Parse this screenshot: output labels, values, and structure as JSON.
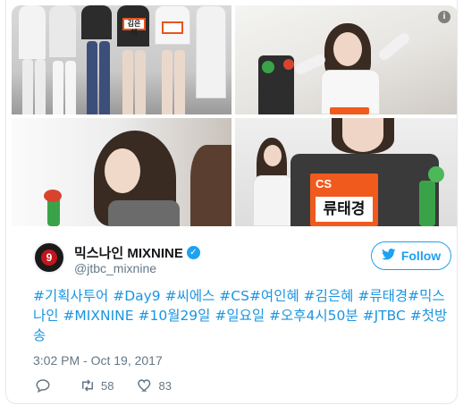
{
  "media": {
    "info_icon": "i"
  },
  "photo_labels": {
    "tag1": "김은혜",
    "tag2": "",
    "bib_team": "CS",
    "bib_name": "류태경"
  },
  "account": {
    "display_name": "믹스나인 MIXNINE",
    "handle": "@jtbc_mixnine",
    "avatar_glyph": "9",
    "verified_glyph": "✓"
  },
  "follow_button": {
    "label": "Follow",
    "icon": "twitter-bird-icon"
  },
  "tweet": {
    "text": "#기획사투어 #Day9 #씨에스 #CS#여인혜 #김은혜 #류태경#믹스나인 #MIXNINE #10월29일 #일요일 #오후4시50분 #JTBC #첫방송",
    "timestamp": "3:02 PM - Oct 19, 2017"
  },
  "actions": {
    "retweets": "58",
    "likes": "83"
  },
  "colors": {
    "link": "#1b95e0",
    "verified": "#1da1f2",
    "muted": "#657786",
    "bib": "#f05a1d"
  }
}
